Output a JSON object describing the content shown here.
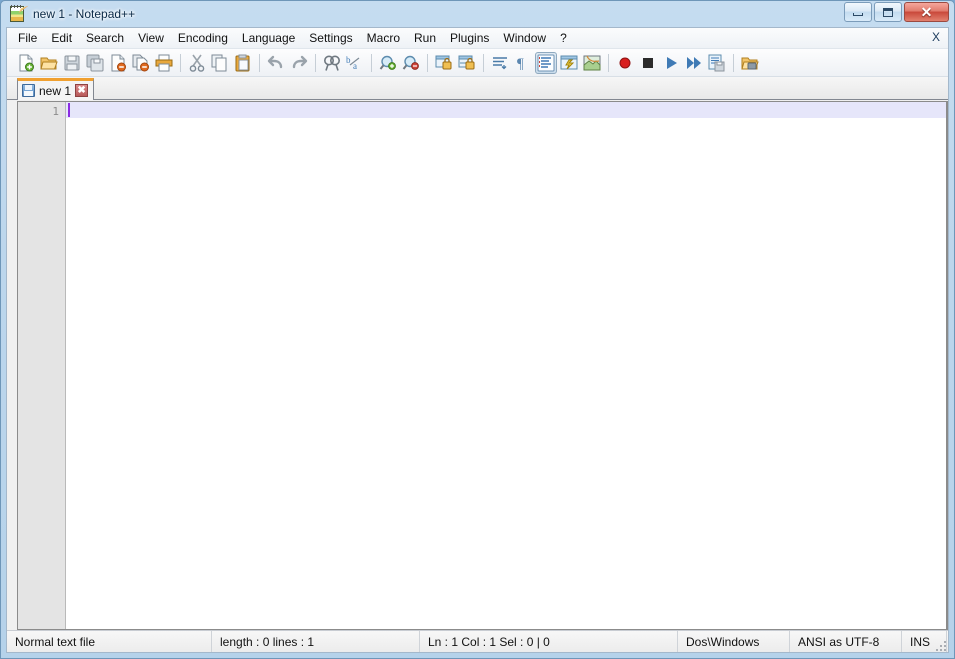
{
  "window": {
    "title": "new 1 - Notepad++",
    "app_icon": "notepad-plus-plus-icon",
    "controls": {
      "minimize": "minimize-button",
      "maximize": "maximize-button",
      "close": "close-button",
      "close_glyph": "✕"
    }
  },
  "menubar": {
    "items": [
      {
        "label": "File"
      },
      {
        "label": "Edit"
      },
      {
        "label": "Search"
      },
      {
        "label": "View"
      },
      {
        "label": "Encoding"
      },
      {
        "label": "Language"
      },
      {
        "label": "Settings"
      },
      {
        "label": "Macro"
      },
      {
        "label": "Run"
      },
      {
        "label": "Plugins"
      },
      {
        "label": "Window"
      },
      {
        "label": "?"
      }
    ],
    "close_document_label": "X"
  },
  "toolbar": {
    "buttons": [
      {
        "name": "new-file-icon",
        "title": "New"
      },
      {
        "name": "open-file-icon",
        "title": "Open"
      },
      {
        "name": "save-icon",
        "title": "Save"
      },
      {
        "name": "save-all-icon",
        "title": "Save All"
      },
      {
        "name": "close-file-icon",
        "title": "Close"
      },
      {
        "name": "close-all-files-icon",
        "title": "Close All"
      },
      {
        "name": "print-icon",
        "title": "Print"
      },
      {
        "name": "cut-icon",
        "title": "Cut"
      },
      {
        "name": "copy-icon",
        "title": "Copy"
      },
      {
        "name": "paste-icon",
        "title": "Paste"
      },
      {
        "name": "undo-icon",
        "title": "Undo"
      },
      {
        "name": "redo-icon",
        "title": "Redo"
      },
      {
        "name": "find-icon",
        "title": "Find"
      },
      {
        "name": "replace-icon",
        "title": "Replace"
      },
      {
        "name": "zoom-in-icon",
        "title": "Zoom In"
      },
      {
        "name": "zoom-out-icon",
        "title": "Zoom Out"
      },
      {
        "name": "sync-vertical-scroll-icon",
        "title": "Synchronize Vertical Scrolling"
      },
      {
        "name": "sync-horizontal-scroll-icon",
        "title": "Synchronize Horizontal Scrolling"
      },
      {
        "name": "word-wrap-icon",
        "title": "Word wrap"
      },
      {
        "name": "show-all-characters-icon",
        "title": "Show All Characters"
      },
      {
        "name": "indent-guide-icon",
        "title": "Show Indent Guide"
      },
      {
        "name": "user-defined-language-icon",
        "title": "User-Defined Dialogue"
      },
      {
        "name": "document-map-icon",
        "title": "Document Map"
      },
      {
        "name": "macro-record-icon",
        "title": "Start Recording"
      },
      {
        "name": "macro-stop-icon",
        "title": "Stop Recording"
      },
      {
        "name": "macro-play-icon",
        "title": "Play Recorded Macro"
      },
      {
        "name": "macro-run-multiple-icon",
        "title": "Run a Macro Multiple Times"
      },
      {
        "name": "macro-save-icon",
        "title": "Save Currently Recorded Macro"
      },
      {
        "name": "run-icon",
        "title": "Run"
      }
    ]
  },
  "tabs": {
    "active": {
      "label": "new  1",
      "close_glyph": "✖",
      "icon": "unsaved-document-icon"
    }
  },
  "editor": {
    "line_numbers": [
      "1"
    ],
    "content": "",
    "caret_color": "#8a2be2",
    "current_line_color": "#e6e6fa"
  },
  "statusbar": {
    "file_type": "Normal text file",
    "length_lines": "length : 0   lines : 1",
    "position": "Ln : 1    Col : 1    Sel : 0 | 0",
    "eol": "Dos\\Windows",
    "encoding": "ANSI as UTF-8",
    "insert_mode": "INS"
  }
}
